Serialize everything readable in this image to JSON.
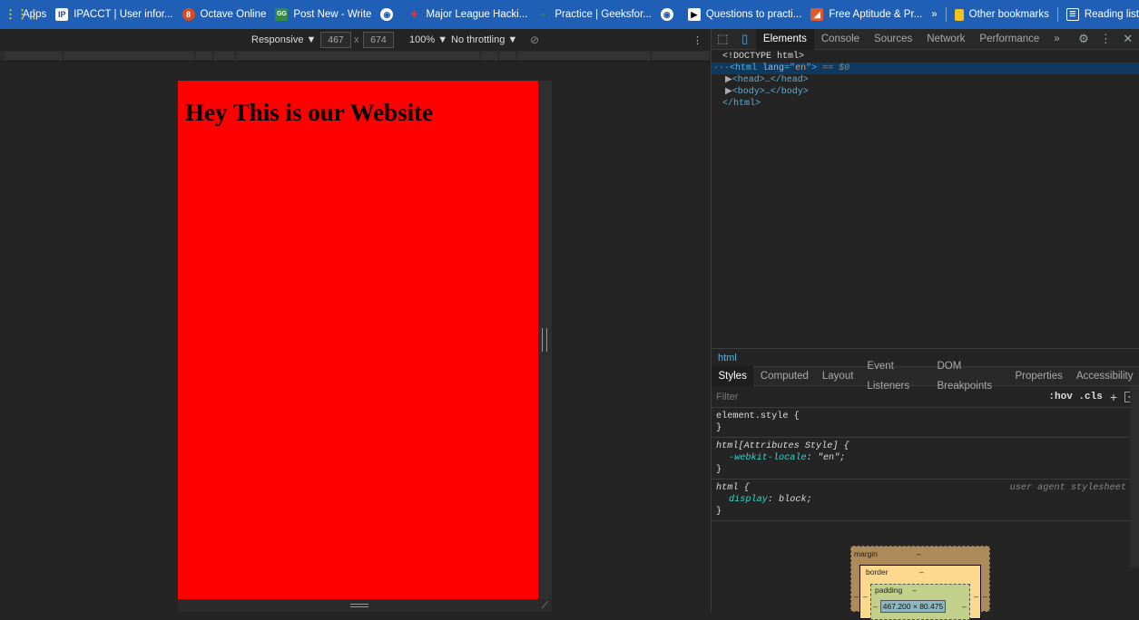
{
  "bookmarks": {
    "apps": "Apps",
    "items": [
      {
        "label": "IPACCT | User infor...",
        "icon": "ipacct-icon",
        "color": "#1d3f9e"
      },
      {
        "label": "Octave Online",
        "icon": "octave-icon",
        "color": "#d94a1e"
      },
      {
        "label": "Post New - Write",
        "icon": "gfg-icon",
        "color": "#2f8d46"
      },
      {
        "label": "",
        "icon": "globe-icon",
        "color": "#ffffff"
      },
      {
        "label": "Major League Hacki...",
        "icon": "mlh-icon",
        "color": "#e73427"
      },
      {
        "label": "Practice | Geeksfor...",
        "icon": "gfg-icon",
        "color": "#2f8d46"
      },
      {
        "label": "",
        "icon": "globe-icon",
        "color": "#ffffff"
      },
      {
        "label": "Questions to practi...",
        "icon": "play-icon",
        "color": "#000000"
      },
      {
        "label": "Free Aptitude & Pr...",
        "icon": "indiabix-icon",
        "color": "#e25b2e"
      }
    ],
    "more": "»",
    "other": "Other bookmarks",
    "reading": "Reading list"
  },
  "emulator": {
    "device": "Responsive ▼",
    "width": "467",
    "times": "x",
    "height": "674",
    "zoom": "100% ▼",
    "throttle": "No throttling ▼",
    "more": "⋮"
  },
  "page": {
    "heading": "Hey This is our Website",
    "background": "#ff0000"
  },
  "devtools": {
    "tabs": [
      "Elements",
      "Console",
      "Sources",
      "Network",
      "Performance"
    ],
    "active_tab": "Elements",
    "overflow": "»",
    "close": "✕",
    "dom": {
      "doctype": "<!DOCTYPE html>",
      "html_open_a": "<html ",
      "html_attr_name": "lang",
      "html_attr_eq": "=\"",
      "html_attr_value": "en",
      "html_open_b": "\">",
      "html_suffix": " == $0",
      "head": "<head>…</head>",
      "body": "<body>…</body>",
      "html_close": "</html>"
    },
    "breadcrumb": "html",
    "sub_tabs": [
      "Styles",
      "Computed",
      "Layout",
      "Event Listeners",
      "DOM Breakpoints",
      "Properties",
      "Accessibility"
    ],
    "filter_placeholder": "Filter",
    "hov_cls": ":hov  .cls",
    "rules": {
      "r1_selector": "element.style {",
      "r1_close": "}",
      "r2_selector": "html[Attributes Style] {",
      "r2_prop": "-webkit-locale",
      "r2_value": "\"en\";",
      "r2_close": "}",
      "r3_selector": "html {",
      "r3_source": "user agent stylesheet",
      "r3_prop": "display",
      "r3_value": "block;",
      "r3_close": "}"
    },
    "box_model": {
      "margin": "margin",
      "margin_val": "–",
      "border": "border",
      "border_val": "–",
      "padding": "padding",
      "padding_val": "–",
      "content": "467.200 × 80.475",
      "dash": "–"
    }
  }
}
